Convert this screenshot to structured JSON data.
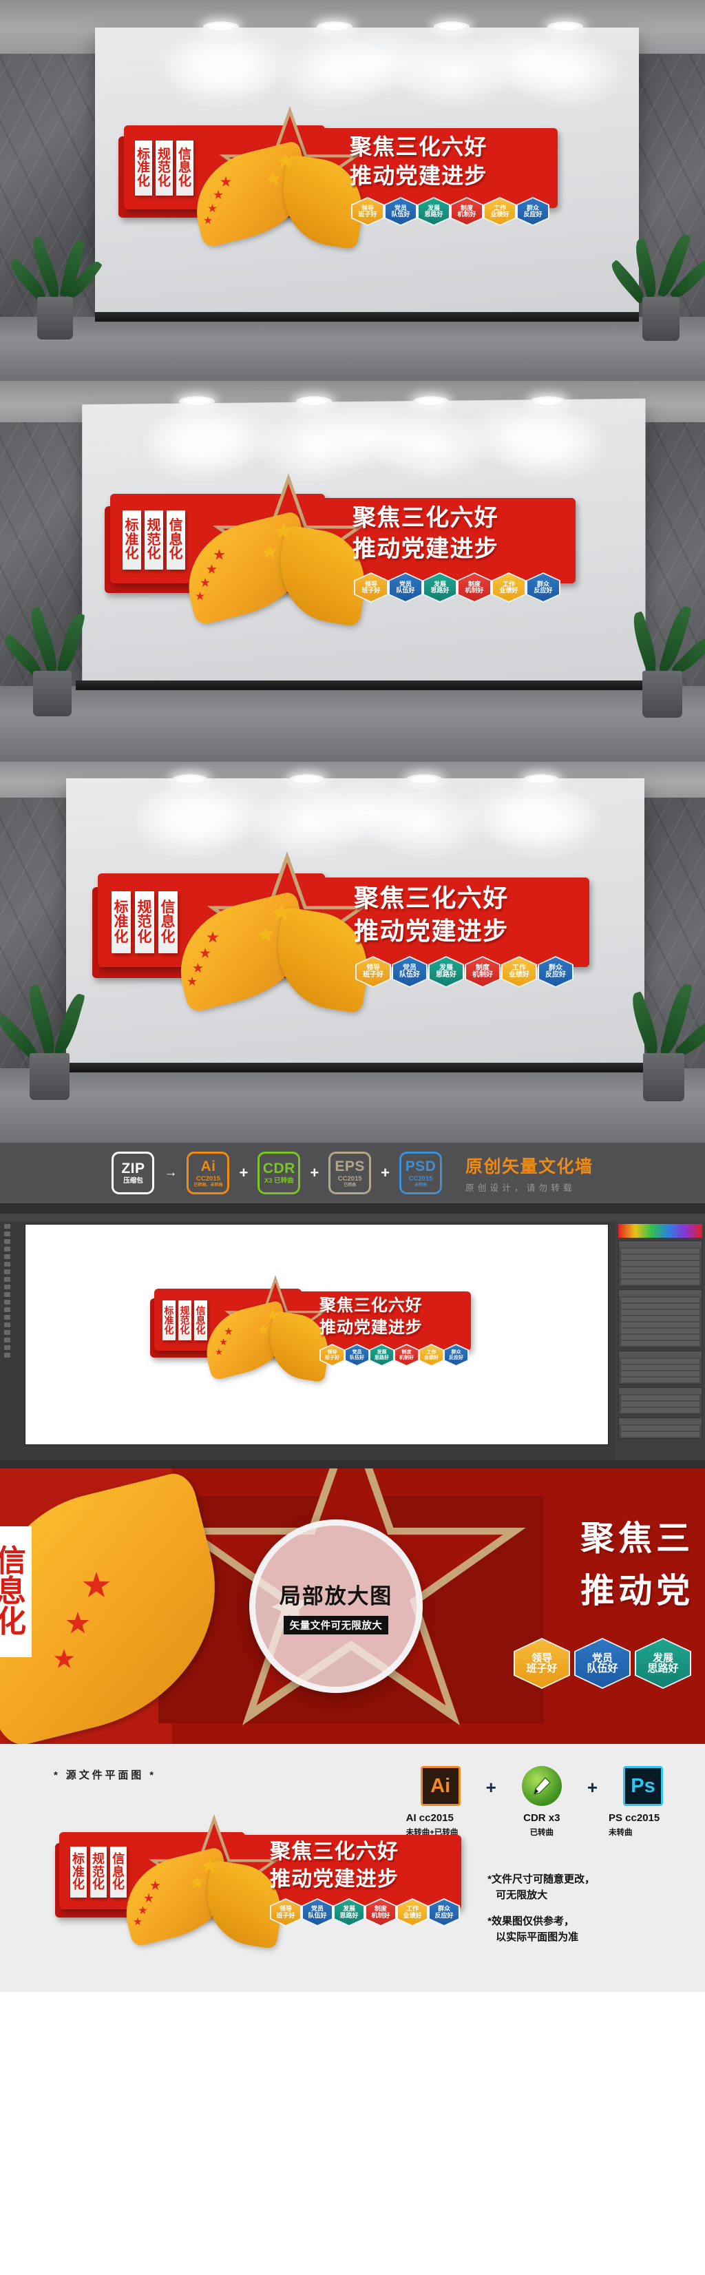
{
  "artwork": {
    "headline_line1": "聚焦三化六好",
    "headline_line2": "推动党建进步",
    "vertical_cards": [
      {
        "chars": [
          "标",
          "准",
          "化"
        ]
      },
      {
        "chars": [
          "规",
          "范",
          "化"
        ]
      },
      {
        "chars": [
          "信",
          "息",
          "化"
        ]
      }
    ],
    "hexagons": [
      {
        "line1": "领导",
        "line2": "班子好",
        "color": "#f0a81e"
      },
      {
        "line1": "党员",
        "line2": "队伍好",
        "color": "#2f76c4"
      },
      {
        "line1": "发展",
        "line2": "思路好",
        "color": "#1fa68e"
      },
      {
        "line1": "制度",
        "line2": "机制好",
        "color": "#e8403a"
      },
      {
        "line1": "工作",
        "line2": "业绩好",
        "color": "#f6c02d"
      },
      {
        "line1": "群众",
        "line2": "反应好",
        "color": "#2f76c4"
      }
    ],
    "colors": {
      "red": "#d81e14",
      "dark_red": "#bd1510",
      "gold": "#c7a579",
      "ribbon_yellow": "#f5a623"
    }
  },
  "format_strip": {
    "boxes": [
      {
        "name": "zip-format-box",
        "big": "ZIP",
        "sub": "压缩包",
        "sub2": "",
        "color": "#ffffff"
      },
      {
        "name": "ai-format-box",
        "big": "Ai",
        "sub": "CC2015",
        "sub2": "已转曲、未转曲",
        "color": "#ef8b12"
      },
      {
        "name": "cdr-format-box",
        "big": "CDR",
        "sub": "X3 已转曲",
        "sub2": "",
        "color": "#79c523"
      },
      {
        "name": "eps-format-box",
        "big": "EPS",
        "sub": "CC2015",
        "sub2": "已转曲",
        "color": "#b3a88c"
      },
      {
        "name": "psd-format-box",
        "big": "PSD",
        "sub": "CC2015",
        "sub2": "未转曲",
        "color": "#3d8fd6"
      }
    ],
    "separators": [
      "→",
      "+",
      "+",
      "+"
    ],
    "title": "原创矢量文化墙",
    "subtitle": "原创设计，请勿转载"
  },
  "closeup": {
    "magnifier_title": "局部放大图",
    "magnifier_caption": "矢量文件可无限放大",
    "headline_line1": "聚焦三",
    "headline_line2": "推动党",
    "left_card_chars": [
      "信",
      "息",
      "化"
    ],
    "hexagons": [
      {
        "line1": "领导",
        "line2": "班子好"
      },
      {
        "line1": "党员",
        "line2": "队伍好"
      },
      {
        "line1": "发展",
        "line2": "思路好"
      }
    ]
  },
  "footer": {
    "source_label": "* 源文件平面图 *",
    "apps": [
      {
        "icon": "adobe-illustrator-icon",
        "glyph": "Ai",
        "label": "AI cc2015",
        "sub": "未转曲+已转曲"
      },
      {
        "icon": "coreldraw-icon",
        "glyph": "",
        "label": "CDR x3",
        "sub": "已转曲"
      },
      {
        "icon": "adobe-photoshop-icon",
        "glyph": "Ps",
        "label": "PS cc2015",
        "sub": "未转曲"
      }
    ],
    "plus": "+",
    "notes": [
      {
        "line1": "*文件尺寸可随意更改，",
        "line2": "可无限放大"
      },
      {
        "line1": "*效果图仅供参考，",
        "line2": "以实际平面图为准"
      }
    ]
  }
}
